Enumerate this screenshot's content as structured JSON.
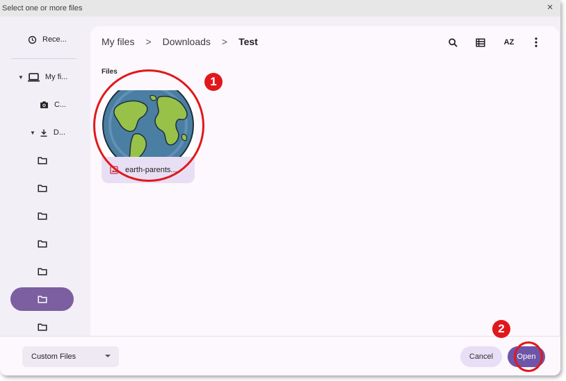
{
  "window": {
    "title": "Select one or more files",
    "close_glyph": "×"
  },
  "sidebar": {
    "items": [
      {
        "label": "Rece...",
        "icon": "clock-icon"
      },
      {
        "label": "My fi...",
        "icon": "laptop-icon"
      },
      {
        "label": "C...",
        "icon": "camera-icon"
      },
      {
        "label": "D...",
        "icon": "download-icon"
      }
    ],
    "folders": [
      {
        "icon": "folder-icon",
        "active": false
      },
      {
        "icon": "folder-icon",
        "active": false
      },
      {
        "icon": "folder-icon",
        "active": false
      },
      {
        "icon": "folder-icon",
        "active": false
      },
      {
        "icon": "folder-icon",
        "active": false
      },
      {
        "icon": "folder-icon",
        "active": true
      },
      {
        "icon": "folder-icon",
        "active": false
      }
    ]
  },
  "breadcrumb": {
    "items": [
      "My files",
      "Downloads",
      "Test"
    ],
    "separator": ">"
  },
  "toolbar": {
    "sort_label": "AZ",
    "icons": [
      "search-icon",
      "list-view-icon",
      "sort-icon",
      "more-vert-icon"
    ]
  },
  "content": {
    "section_label": "Files",
    "files": [
      {
        "name": "earth-parents...",
        "type_icon": "image-file-icon",
        "thumbnail": "globe"
      }
    ]
  },
  "annotations": {
    "badge_1": "1",
    "badge_2": "2",
    "color": "#e0181b"
  },
  "footer": {
    "file_type": "Custom Files",
    "cancel_label": "Cancel",
    "open_label": "Open"
  },
  "colors": {
    "accent": "#6e55a8",
    "active_folder": "#7b5fa0",
    "cancel_bg": "#e8dff6"
  }
}
